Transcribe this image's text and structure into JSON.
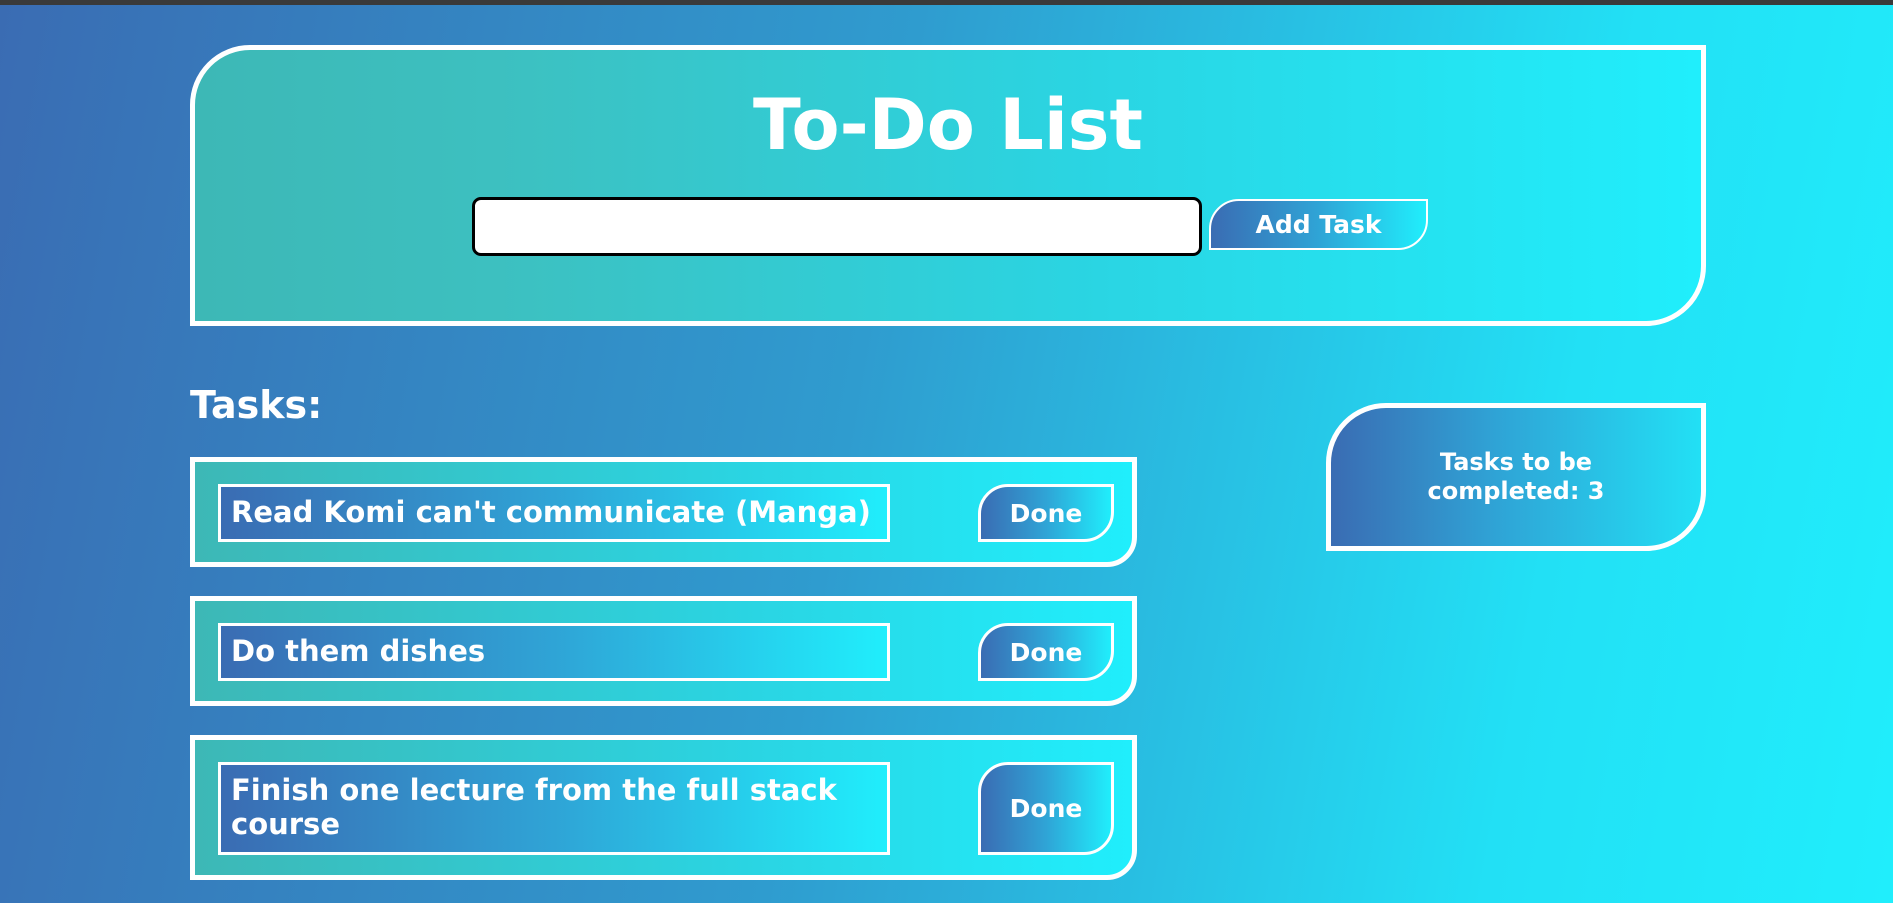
{
  "app": {
    "title": "To-Do List"
  },
  "new_task": {
    "value": "",
    "placeholder": "",
    "add_label": "Add Task"
  },
  "tasks_heading": "Tasks:",
  "tasks": [
    {
      "text": "Read Komi can't communicate (Manga)",
      "done_label": "Done"
    },
    {
      "text": "Do them dishes",
      "done_label": "Done"
    },
    {
      "text": "Finish one lecture from the full stack course",
      "done_label": "Done"
    }
  ],
  "counter": {
    "text": "Tasks to be completed: 3"
  },
  "colors": {
    "background_start": "#3a6cb3",
    "background_end": "#20eefc",
    "card_border": "#ffffff",
    "text": "#ffffff"
  }
}
